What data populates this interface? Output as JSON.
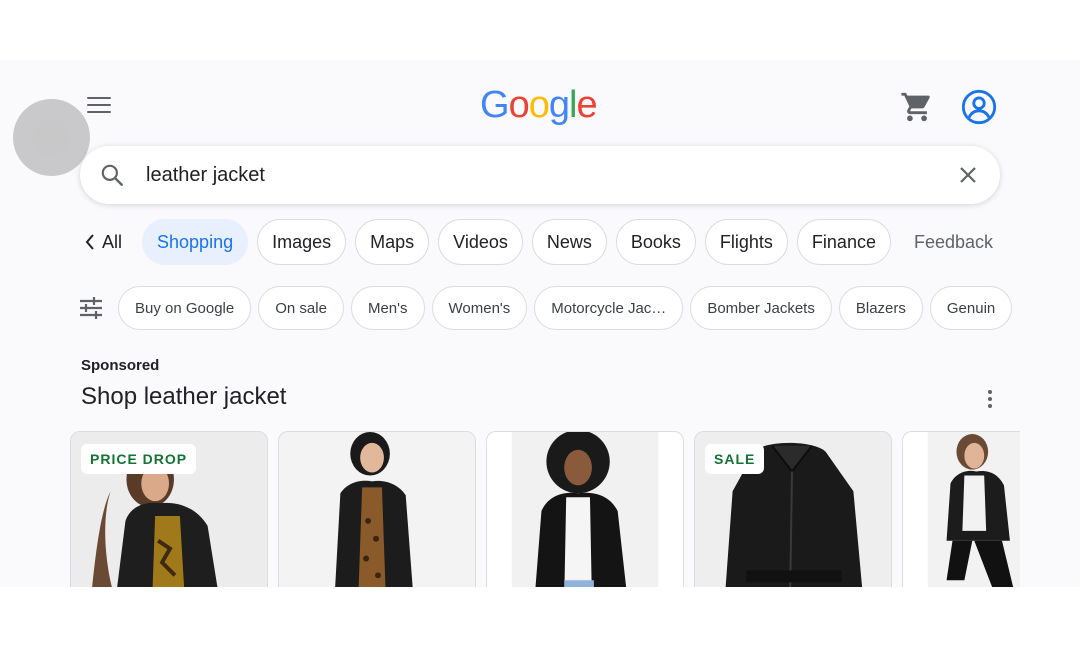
{
  "header": {
    "logo_letters": [
      {
        "ch": "G",
        "color": "#4285f4"
      },
      {
        "ch": "o",
        "color": "#ea4335"
      },
      {
        "ch": "o",
        "color": "#fbbc05"
      },
      {
        "ch": "g",
        "color": "#4285f4"
      },
      {
        "ch": "l",
        "color": "#34a853"
      },
      {
        "ch": "e",
        "color": "#ea4335"
      }
    ],
    "icons": {
      "menu": "hamburger-menu-icon",
      "cart": "shopping-cart-icon",
      "account": "account-circle-icon"
    }
  },
  "search": {
    "query": "leather jacket"
  },
  "tabs": {
    "back_label": "All",
    "items": [
      {
        "label": "Shopping",
        "active": true
      },
      {
        "label": "Images"
      },
      {
        "label": "Maps"
      },
      {
        "label": "Videos"
      },
      {
        "label": "News"
      },
      {
        "label": "Books"
      },
      {
        "label": "Flights"
      },
      {
        "label": "Finance"
      }
    ],
    "feedback_label": "Feedback"
  },
  "filters": {
    "chips": [
      "Buy on Google",
      "On sale",
      "Men's",
      "Women's",
      "Motorcycle Jac…",
      "Bomber Jackets",
      "Blazers",
      "Genuin"
    ]
  },
  "sponsored": {
    "label": "Sponsored",
    "title": "Shop leather jacket"
  },
  "products": [
    {
      "badge": "PRICE DROP"
    },
    {
      "badge": ""
    },
    {
      "badge": ""
    },
    {
      "badge": "SALE"
    },
    {
      "badge": ""
    }
  ],
  "colors": {
    "accent": "#1a73e8",
    "active_tab_bg": "#e8f0fe",
    "badge_text": "#137333",
    "account_icon": "#1a73e8"
  }
}
